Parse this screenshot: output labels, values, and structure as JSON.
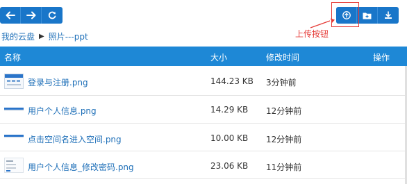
{
  "toolbar": {
    "left_buttons": [
      {
        "icon": "arrow-left-icon"
      },
      {
        "icon": "arrow-right-icon"
      },
      {
        "icon": "refresh-icon"
      }
    ],
    "right_buttons": [
      {
        "icon": "upload-icon"
      },
      {
        "icon": "new-folder-icon"
      },
      {
        "icon": "download-icon"
      }
    ],
    "accent_color": "#1976c9"
  },
  "annotation": {
    "label": "上传按钮",
    "color": "#e53935"
  },
  "breadcrumb": {
    "root": "我的云盘",
    "current": "照片---ppt"
  },
  "table": {
    "headers": {
      "name": "名称",
      "size": "大小",
      "modified": "修改时间",
      "actions": "操作"
    },
    "header_color": "#1e88d6",
    "rows": [
      {
        "name": "登录与注册.png",
        "size": "144.23 KB",
        "time": "3分钟前"
      },
      {
        "name": "用户个人信息.png",
        "size": "14.29 KB",
        "time": "12分钟前"
      },
      {
        "name": "点击空间名进入空间.png",
        "size": "10.00 KB",
        "time": "12分钟前"
      },
      {
        "name": "用户个人信息_修改密码.png",
        "size": "23.06 KB",
        "time": "11分钟前"
      }
    ]
  }
}
